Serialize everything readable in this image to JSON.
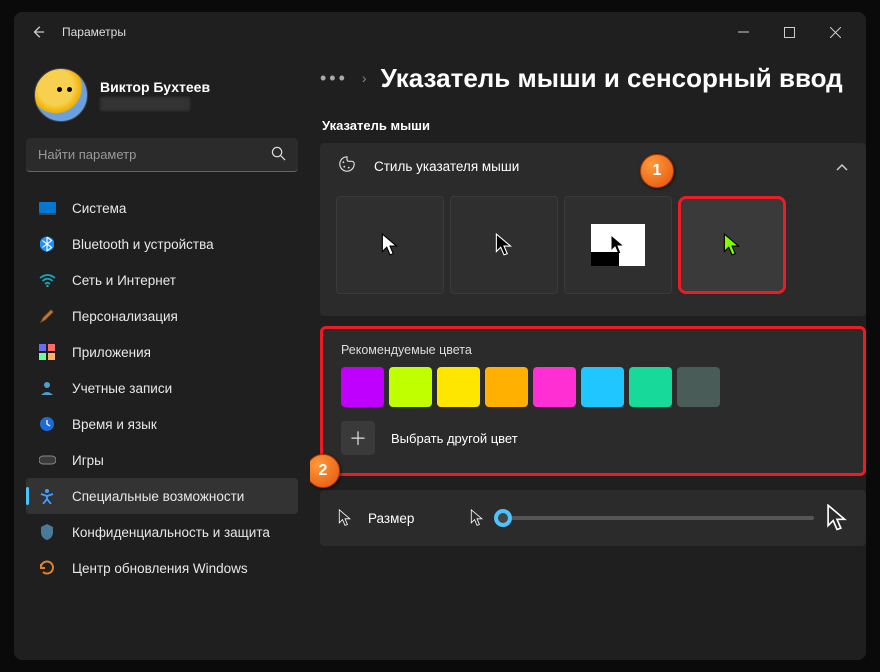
{
  "window": {
    "title": "Параметры"
  },
  "profile": {
    "name": "Виктор Бухтеев"
  },
  "search": {
    "placeholder": "Найти параметр"
  },
  "sidebar": {
    "items": [
      {
        "label": "Система",
        "icon": "system"
      },
      {
        "label": "Bluetooth и устройства",
        "icon": "bluetooth"
      },
      {
        "label": "Сеть и Интернет",
        "icon": "wifi"
      },
      {
        "label": "Персонализация",
        "icon": "brush"
      },
      {
        "label": "Приложения",
        "icon": "apps"
      },
      {
        "label": "Учетные записи",
        "icon": "account"
      },
      {
        "label": "Время и язык",
        "icon": "time"
      },
      {
        "label": "Игры",
        "icon": "games"
      },
      {
        "label": "Специальные возможности",
        "icon": "accessibility",
        "selected": true
      },
      {
        "label": "Конфиденциальность и защита",
        "icon": "privacy"
      },
      {
        "label": "Центр обновления Windows",
        "icon": "update"
      }
    ]
  },
  "breadcrumb": {
    "title": "Указатель мыши и сенсорный ввод"
  },
  "section": {
    "pointer": "Указатель мыши"
  },
  "pointerStyle": {
    "title": "Стиль указателя мыши"
  },
  "colors": {
    "label": "Рекомендуемые цвета",
    "swatches": [
      "#c000ff",
      "#bfff00",
      "#ffe600",
      "#ffb000",
      "#ff2fd4",
      "#1fc6ff",
      "#17d99a",
      "#4a5c58"
    ],
    "custom_label": "Выбрать другой цвет"
  },
  "size": {
    "label": "Размер"
  },
  "annotations": {
    "one": "1",
    "two": "2"
  }
}
